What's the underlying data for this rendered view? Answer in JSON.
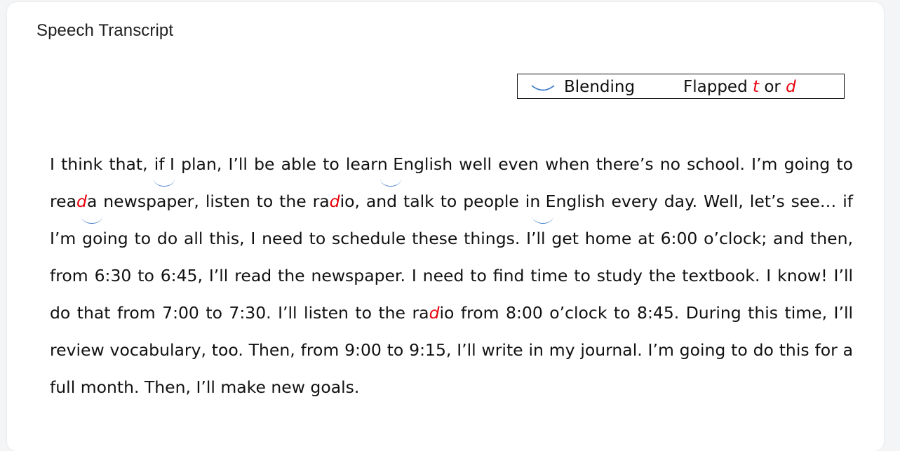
{
  "title": "Speech Transcript",
  "legend": {
    "blending_label": "Blending",
    "flapped_prefix": "Flapped ",
    "flapped_t": "t",
    "flapped_or": " or ",
    "flapped_d": "d"
  },
  "colors": {
    "flap_red": "#e8000b",
    "blend_blue": "#3a78c9"
  },
  "transcript": {
    "s01": "I think that, ",
    "b01": "if I",
    "s02": " plan, I’ll be able to lear",
    "b02": "n E",
    "s03": "nglish well even when there’s no school. I’m going to rea",
    "r01": "d",
    "b03": " a",
    "s04": " newspaper, listen to the ra",
    "r02": "d",
    "s05": "io, and talk to people i",
    "b04": "n E",
    "s06": "nglish every day. Well, let’s see… if I’m going to do all this, I need to schedule these things. I’ll get home at 6:00 o’clock; and then, from 6:30 to 6:45, I’ll read the newspaper. I need to find time to study the textbook. I know! I’ll do that from 7:00 to 7:30. I’ll listen to the ra",
    "r03": "d",
    "s07": "io from 8:00 o’clock to 8:45. During this time, I’ll review vocabulary, too. Then, from 9:00 to 9:15, I’ll write in my journal. I’m going to do this for a full month. Then, I’ll make new goals."
  }
}
